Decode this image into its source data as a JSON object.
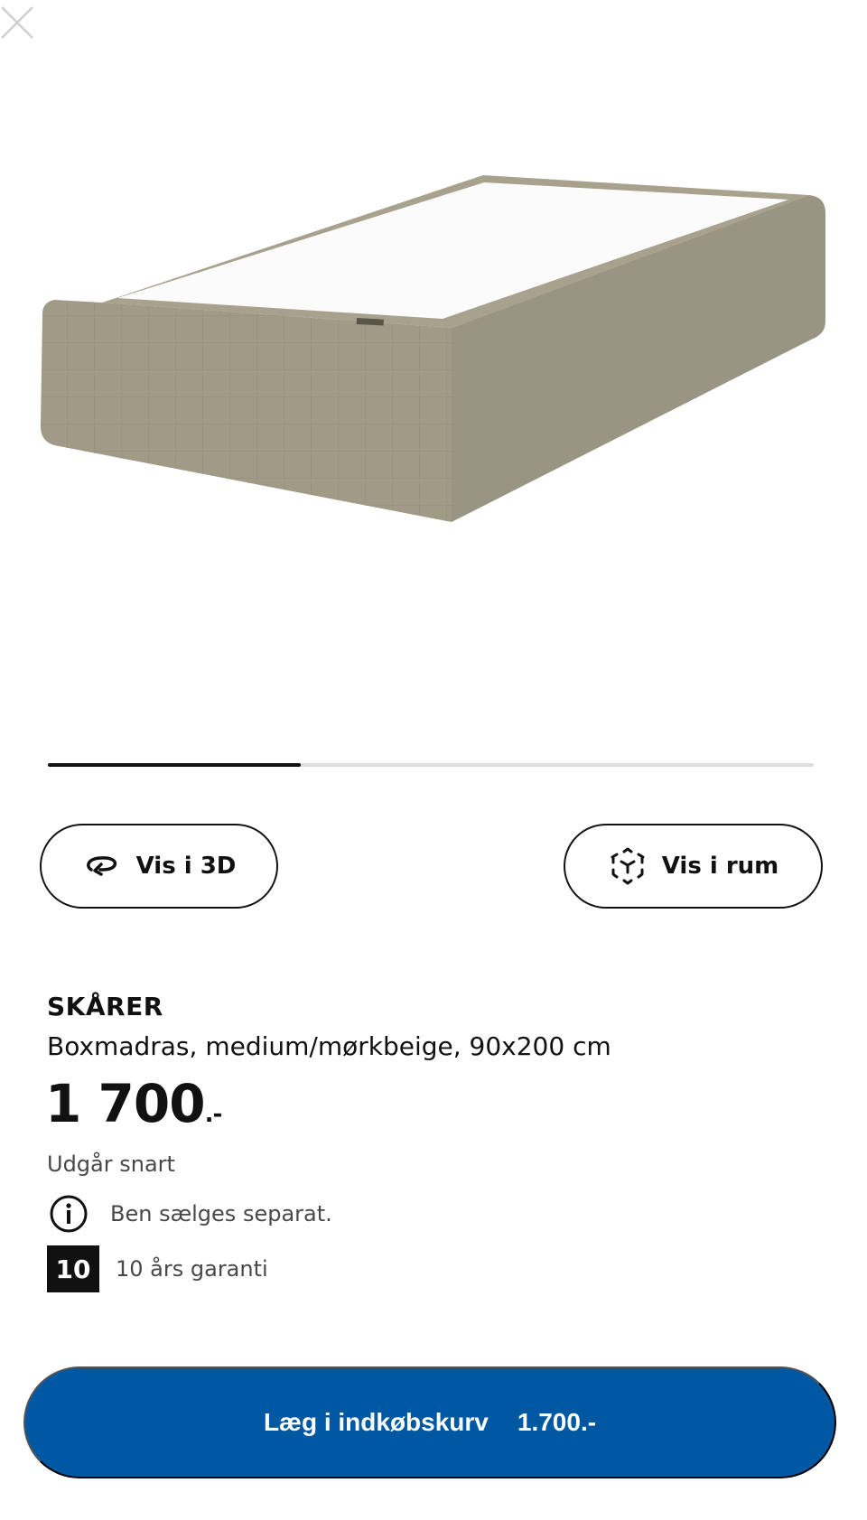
{
  "header": {
    "close_icon": "close-icon"
  },
  "gallery": {
    "progress": 0.33,
    "image_alt": "SKÅRER boxmadras"
  },
  "actions": {
    "view_3d": {
      "label": "Vis i 3D",
      "icon": "rotate-3d-icon"
    },
    "view_room": {
      "label": "Vis i rum",
      "icon": "ar-cube-icon"
    }
  },
  "product": {
    "name": "SKÅRER",
    "description": "Boxmadras, medium/mørkbeige, 90x200 cm",
    "price": "1 700",
    "price_suffix": ".-",
    "status": "Udgår snart",
    "info_icon": "info-icon",
    "info_text": "Ben sælges separat.",
    "warranty_badge": "10",
    "warranty_text": "10 års garanti"
  },
  "cart": {
    "label": "Læg i indkøbskurv",
    "price": "1.700.-"
  },
  "colors": {
    "accent": "#0058a3",
    "fabric": "#a09a87",
    "text": "#111111",
    "muted": "#484848"
  }
}
